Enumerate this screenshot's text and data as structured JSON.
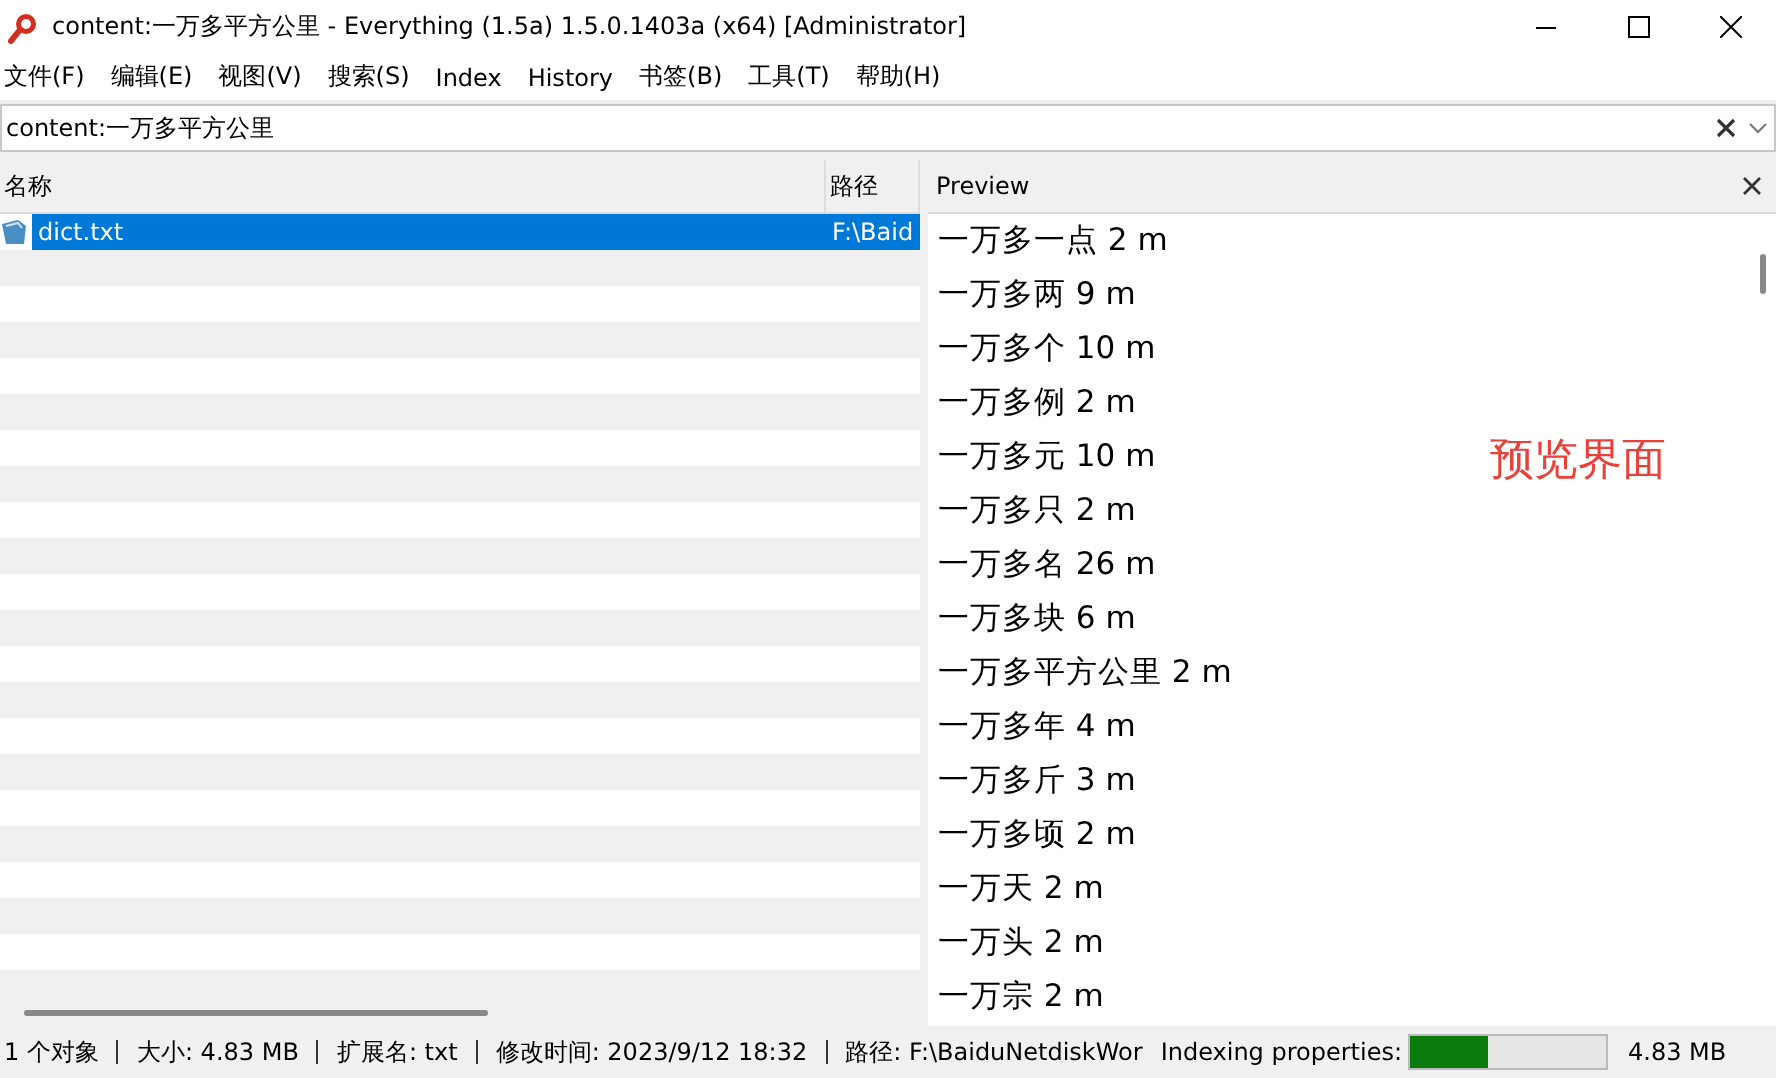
{
  "window": {
    "title": "content:一万多平方公里 - Everything (1.5a) 1.5.0.1403a (x64) [Administrator]"
  },
  "menu": [
    "文件(F)",
    "编辑(E)",
    "视图(V)",
    "搜索(S)",
    "Index",
    "History",
    "书签(B)",
    "工具(T)",
    "帮助(H)"
  ],
  "search": {
    "value": "content:一万多平方公里"
  },
  "results": {
    "columns": [
      "名称",
      "路径"
    ],
    "rows": [
      {
        "name": "dict.txt",
        "path": "F:\\Baid",
        "selected": true
      }
    ]
  },
  "preview": {
    "title": "Preview",
    "lines": [
      "一万多一点 2 m",
      "一万多两 9 m",
      "一万多个 10 m",
      "一万多例 2 m",
      "一万多元 10 m",
      "一万多只 2 m",
      "一万多名 26 m",
      "一万多块 6 m",
      "一万多平方公里 2 m",
      "一万多年 4 m",
      "一万多斤 3 m",
      "一万多顷 2 m",
      "一万天 2 m",
      "一万头 2 m",
      "一万宗 2 m"
    ],
    "annotation": "预览界面"
  },
  "status_bar": {
    "items": [
      "1 个对象",
      "大小: 4.83 MB",
      "扩展名: txt",
      "修改时间: 2023/9/12 18:32",
      "路径: F:\\BaiduNetdiskWor"
    ],
    "indexing_label": "Indexing properties:",
    "level": 0.4,
    "size": "4.83 MB"
  }
}
